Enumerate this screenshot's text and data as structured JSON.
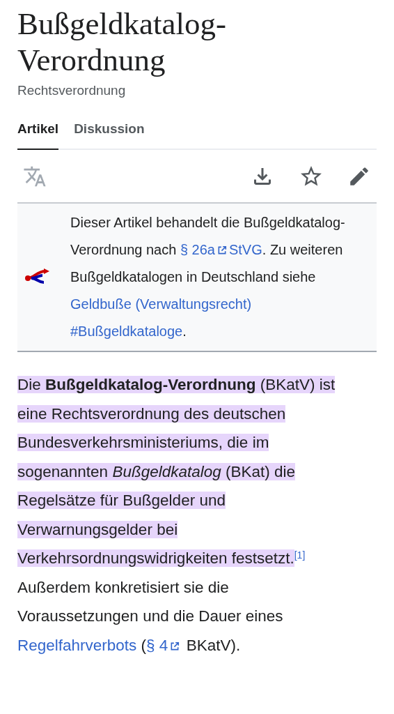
{
  "title": "Bußgeldkatalog-Verordnung",
  "subtitle": "Rechtsverordnung",
  "tabs": [
    {
      "label": "Artikel",
      "selected": true
    },
    {
      "label": "Diskussion",
      "selected": false
    }
  ],
  "hatnote": [
    {
      "kind": "text",
      "text": "Dieser Artikel behandelt die Bußgeldkatalog-Verordnung nach "
    },
    {
      "kind": "external",
      "text": "§ 26a"
    },
    {
      "kind": "link",
      "text": "StVG"
    },
    {
      "kind": "text",
      "text": ". Zu weiteren Bußgeldkatalogen in Deutschland siehe "
    },
    {
      "kind": "link",
      "text": "Geldbuße (Verwaltungsrecht)"
    },
    {
      "kind": "link",
      "text": "#Bußgeldkataloge"
    },
    {
      "kind": "text",
      "text": "."
    }
  ],
  "paragraph": [
    {
      "kind": "text",
      "highlighted": true,
      "text": "Die **Bußgeldkatalog-Verordnung** (BKatV) ist eine Rechtsverordnung des deutschen Bundesverkehrsministeriums, die im sogenannten *Bußgeldkatalog* (BKat) die Regelsätze für Bußgelder und Verwarnungsgelder bei Verkehrsordnungswidrigkeiten festsetzt."
    },
    {
      "kind": "ref",
      "highlighted": false,
      "text": "[1]"
    },
    {
      "kind": "text",
      "highlighted": false,
      "text": " Außerdem konkretisiert sie die Voraussetzungen und die Dauer eines "
    },
    {
      "kind": "link",
      "highlighted": false,
      "text": "Regelfahrverbots"
    },
    {
      "kind": "text",
      "highlighted": false,
      "text": " ("
    },
    {
      "kind": "external",
      "highlighted": false,
      "text": "§ 4"
    },
    {
      "kind": "text",
      "highlighted": false,
      "text": " BKatV)."
    }
  ]
}
